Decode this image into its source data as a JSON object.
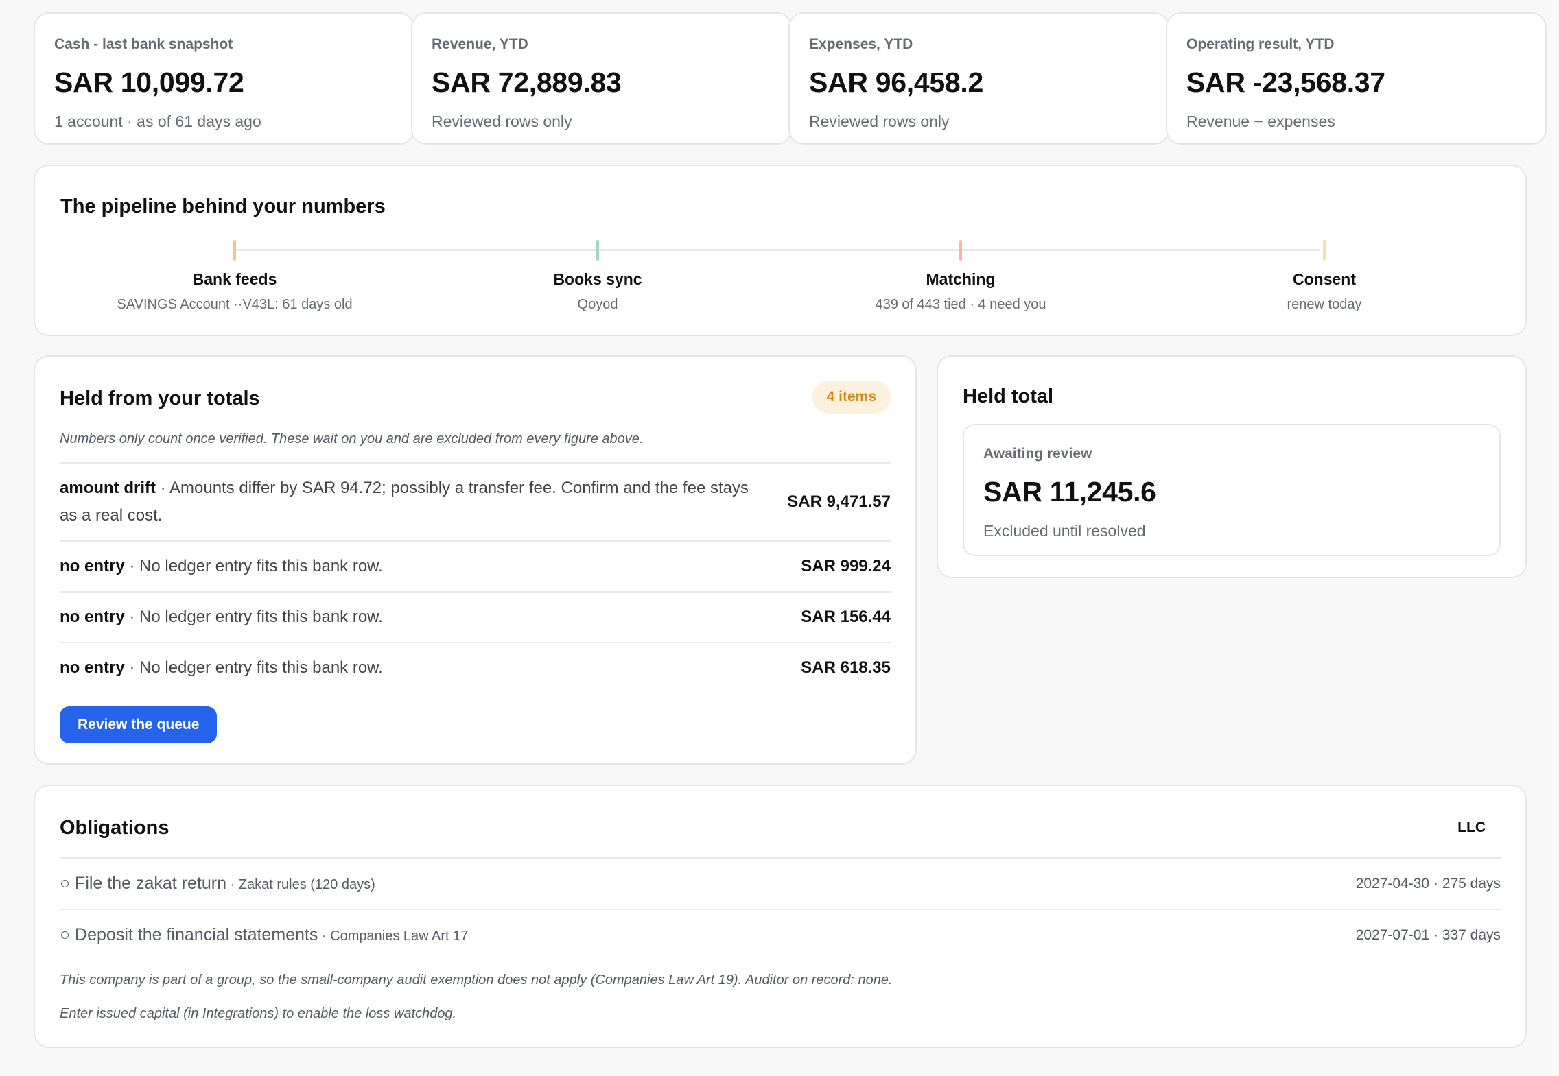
{
  "kpis": [
    {
      "label": "Cash - last bank snapshot",
      "value": "SAR 10,099.72",
      "sub": "1 account · as of 61 days ago"
    },
    {
      "label": "Revenue, YTD",
      "value": "SAR 72,889.83",
      "sub": "Reviewed rows only"
    },
    {
      "label": "Expenses, YTD",
      "value": "SAR 96,458.2",
      "sub": "Reviewed rows only"
    },
    {
      "label": "Operating result, YTD",
      "value": "SAR -23,568.37",
      "sub": "Revenue − expenses"
    }
  ],
  "pipeline": {
    "title": "The pipeline behind your numbers",
    "steps": [
      {
        "name": "Bank feeds",
        "desc": "SAVINGS Account ··V43L: 61 days old",
        "color": "#f5c48a"
      },
      {
        "name": "Books sync",
        "desc": "Qoyod",
        "color": "#9fd4c8"
      },
      {
        "name": "Matching",
        "desc": "439 of 443 tied · 4 need you",
        "color": "#f2b8a0"
      },
      {
        "name": "Consent",
        "desc": "renew today",
        "color": "#f5e0a8"
      }
    ]
  },
  "held": {
    "title": "Held from your totals",
    "badge": "4 items",
    "note": "Numbers only count once verified. These wait on you and are excluded from every figure above.",
    "rows": [
      {
        "tag": "amount drift",
        "sep": " · ",
        "text": "Amounts differ by SAR 94.72; possibly a transfer fee. Confirm and the fee stays as a real cost.",
        "amount": "SAR 9,471.57"
      },
      {
        "tag": "no entry",
        "sep": " · ",
        "text": "No ledger entry fits this bank row.",
        "amount": "SAR 999.24"
      },
      {
        "tag": "no entry",
        "sep": " · ",
        "text": "No ledger entry fits this bank row.",
        "amount": "SAR 156.44"
      },
      {
        "tag": "no entry",
        "sep": " · ",
        "text": "No ledger entry fits this bank row.",
        "amount": "SAR 618.35"
      }
    ],
    "button": "Review the queue"
  },
  "held_total": {
    "title": "Held total",
    "label": "Awaiting review",
    "value": "SAR 11,245.6",
    "sub": "Excluded until resolved"
  },
  "obligations": {
    "title": "Obligations",
    "entity_type": "LLC",
    "items": [
      {
        "marker": "○ ",
        "name": "File the zakat return",
        "sep": " · ",
        "ref": "Zakat rules (120 days)",
        "due": "2027-04-30 · 275 days"
      },
      {
        "marker": "○ ",
        "name": "Deposit the financial statements",
        "sep": " · ",
        "ref": "Companies Law Art 17",
        "due": "2027-07-01 · 337 days"
      }
    ],
    "notes": [
      "This company is part of a group, so the small-company audit exemption does not apply (Companies Law Art 19). Auditor on record: none.",
      "Enter issued capital (in Integrations) to enable the loss watchdog."
    ]
  }
}
